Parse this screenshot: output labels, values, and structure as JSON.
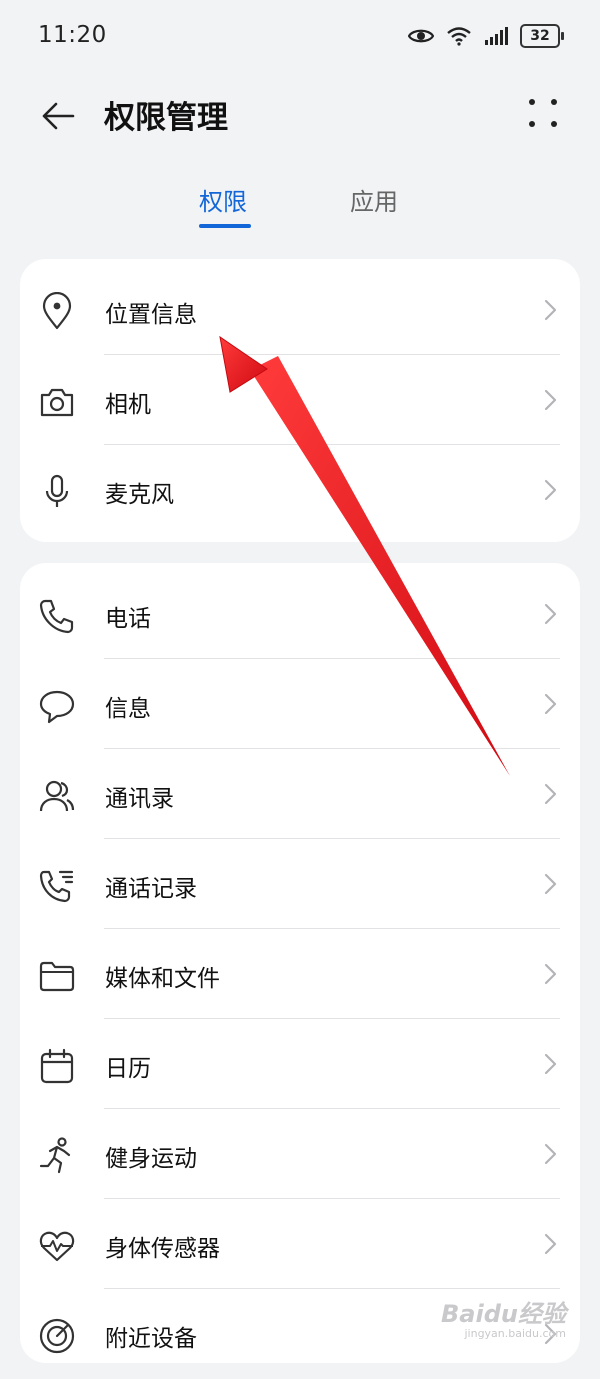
{
  "status_bar": {
    "time": "11:20",
    "battery": "32"
  },
  "header": {
    "title": "权限管理"
  },
  "tabs": [
    {
      "label": "权限",
      "active": true
    },
    {
      "label": "应用",
      "active": false
    }
  ],
  "group1": [
    {
      "label": "位置信息",
      "icon": "location-pin-icon"
    },
    {
      "label": "相机",
      "icon": "camera-icon"
    },
    {
      "label": "麦克风",
      "icon": "microphone-icon"
    }
  ],
  "group2": [
    {
      "label": "电话",
      "icon": "phone-icon"
    },
    {
      "label": "信息",
      "icon": "message-bubble-icon"
    },
    {
      "label": "通讯录",
      "icon": "contacts-icon"
    },
    {
      "label": "通话记录",
      "icon": "call-log-icon"
    },
    {
      "label": "媒体和文件",
      "icon": "folder-icon"
    },
    {
      "label": "日历",
      "icon": "calendar-icon"
    },
    {
      "label": "健身运动",
      "icon": "running-icon"
    },
    {
      "label": "身体传感器",
      "icon": "heart-rate-icon"
    },
    {
      "label": "附近设备",
      "icon": "nearby-devices-icon"
    }
  ],
  "colors": {
    "accent": "#1266d8",
    "annotation_arrow": "#e8141a",
    "background": "#f1f3f5"
  },
  "watermark": {
    "main": "Baidu经验",
    "sub": "jingyan.baidu.com"
  }
}
